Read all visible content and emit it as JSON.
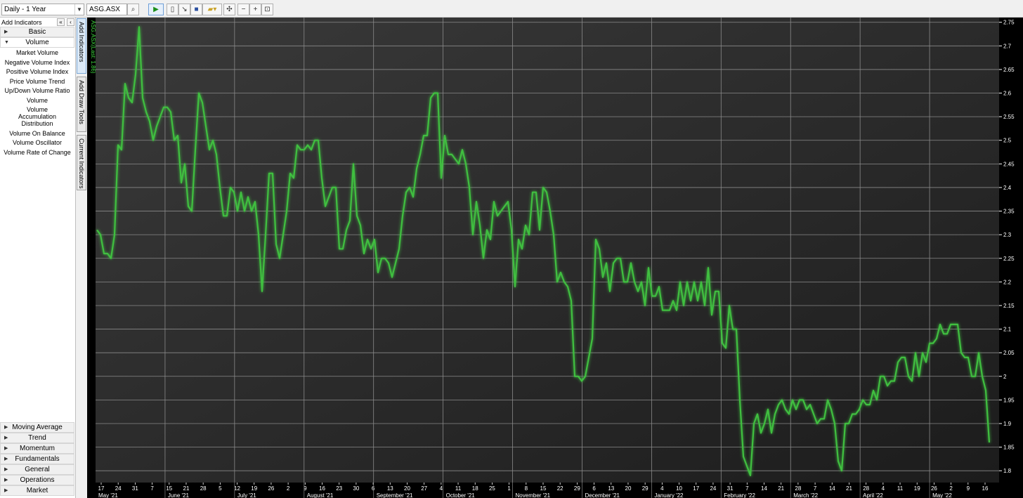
{
  "toolbar": {
    "period_select": "Daily - 1 Year",
    "symbol_input": "ASG.ASX",
    "icons": [
      "search-icon",
      "play-icon",
      "new-icon",
      "export-icon",
      "save-icon",
      "open-icon",
      "settings-icon",
      "zoom-out-icon",
      "zoom-in-icon",
      "fit-icon"
    ]
  },
  "sidebar": {
    "title": "Add Indicators",
    "collapse_left": "«",
    "collapse": "‹",
    "categories_top": [
      {
        "label": "Basic",
        "open": false
      },
      {
        "label": "Volume",
        "open": true
      }
    ],
    "volume_items": [
      "Market Volume",
      "Negative Volume Index",
      "Positive Volume Index",
      "Price Volume Trend",
      "Up/Down Volume Ratio",
      "Volume",
      "Volume Accumulation Distribution",
      "Volume On Balance",
      "Volume Oscillator",
      "Volume Rate of Change"
    ],
    "categories_bottom": [
      "Moving Average",
      "Trend",
      "Momentum",
      "Fundamentals",
      "General",
      "Operations",
      "Market"
    ]
  },
  "vertical_tabs": [
    "Add Indicators",
    "Add Draw Tools",
    "Current Indicators"
  ],
  "chart_data": {
    "type": "line",
    "series": [
      {
        "name": "ASG.ASX",
        "color": "#3fbf3f",
        "values": [
          2.31,
          2.3,
          2.26,
          2.26,
          2.25,
          2.3,
          2.49,
          2.48,
          2.62,
          2.59,
          2.58,
          2.64,
          2.74,
          2.59,
          2.56,
          2.54,
          2.5,
          2.53,
          2.55,
          2.57,
          2.57,
          2.56,
          2.5,
          2.51,
          2.41,
          2.45,
          2.36,
          2.35,
          2.48,
          2.6,
          2.58,
          2.53,
          2.48,
          2.5,
          2.47,
          2.4,
          2.34,
          2.34,
          2.4,
          2.39,
          2.35,
          2.39,
          2.35,
          2.38,
          2.35,
          2.37,
          2.3,
          2.18,
          2.3,
          2.43,
          2.43,
          2.28,
          2.25,
          2.3,
          2.35,
          2.43,
          2.42,
          2.49,
          2.48,
          2.48,
          2.49,
          2.48,
          2.5,
          2.5,
          2.42,
          2.36,
          2.38,
          2.4,
          2.4,
          2.27,
          2.27,
          2.31,
          2.33,
          2.45,
          2.34,
          2.32,
          2.26,
          2.29,
          2.27,
          2.29,
          2.22,
          2.25,
          2.25,
          2.24,
          2.21,
          2.24,
          2.27,
          2.34,
          2.39,
          2.4,
          2.38,
          2.44,
          2.47,
          2.51,
          2.51,
          2.59,
          2.6,
          2.6,
          2.42,
          2.51,
          2.47,
          2.47,
          2.46,
          2.45,
          2.48,
          2.45,
          2.4,
          2.3,
          2.37,
          2.32,
          2.25,
          2.31,
          2.29,
          2.37,
          2.34,
          2.35,
          2.36,
          2.37,
          2.31,
          2.19,
          2.29,
          2.27,
          2.32,
          2.3,
          2.39,
          2.39,
          2.31,
          2.4,
          2.39,
          2.35,
          2.3,
          2.2,
          2.22,
          2.2,
          2.19,
          2.16,
          2.0,
          2.0,
          1.99,
          2.0,
          2.04,
          2.08,
          2.29,
          2.27,
          2.21,
          2.24,
          2.18,
          2.24,
          2.25,
          2.25,
          2.2,
          2.2,
          2.24,
          2.2,
          2.18,
          2.2,
          2.15,
          2.23,
          2.17,
          2.17,
          2.19,
          2.14,
          2.14,
          2.14,
          2.16,
          2.14,
          2.2,
          2.15,
          2.2,
          2.16,
          2.2,
          2.16,
          2.2,
          2.15,
          2.23,
          2.13,
          2.18,
          2.18,
          2.07,
          2.06,
          2.15,
          2.1,
          2.1,
          1.95,
          1.83,
          1.81,
          1.79,
          1.9,
          1.92,
          1.88,
          1.9,
          1.93,
          1.88,
          1.92,
          1.94,
          1.95,
          1.93,
          1.92,
          1.95,
          1.93,
          1.95,
          1.95,
          1.93,
          1.94,
          1.92,
          1.9,
          1.91,
          1.91,
          1.95,
          1.93,
          1.9,
          1.82,
          1.8,
          1.9,
          1.9,
          1.92,
          1.92,
          1.93,
          1.95,
          1.94,
          1.94,
          1.97,
          1.95,
          2.0,
          2.0,
          1.98,
          1.99,
          1.99,
          2.03,
          2.04,
          2.04,
          2.0,
          1.99,
          2.05,
          2.0,
          2.05,
          2.03,
          2.07,
          2.07,
          2.08,
          2.11,
          2.09,
          2.09,
          2.11,
          2.11,
          2.11,
          2.05,
          2.04,
          2.04,
          2.0,
          2.0,
          2.05,
          2.0,
          1.97,
          1.86
        ]
      }
    ],
    "ylim": [
      1.775,
      2.76
    ],
    "y_ticks": [
      "1.8",
      "1.85",
      "1.9",
      "1.95",
      "2",
      "2.05",
      "2.1",
      "2.15",
      "2.2",
      "2.25",
      "2.3",
      "2.35",
      "2.4",
      "2.45",
      "2.5",
      "2.55",
      "2.6",
      "2.65",
      "2.7",
      "2.75"
    ],
    "x_day_ticks": [
      "17",
      "24",
      "31",
      "7",
      "15",
      "21",
      "28",
      "5",
      "12",
      "19",
      "26",
      "2",
      "9",
      "16",
      "23",
      "30",
      "6",
      "13",
      "20",
      "27",
      "4",
      "11",
      "18",
      "25",
      "1",
      "8",
      "15",
      "22",
      "29",
      "6",
      "13",
      "20",
      "29",
      "4",
      "10",
      "17",
      "24",
      "31",
      "7",
      "14",
      "21",
      "28",
      "7",
      "14",
      "21",
      "28",
      "4",
      "11",
      "19",
      "26",
      "2",
      "9",
      "16"
    ],
    "x_month_labels": [
      "May '21",
      "June '21",
      "July '21",
      "August '21",
      "September '21",
      "October '21",
      "November '21",
      "December '21",
      "January '22",
      "February '22",
      "March '22",
      "April '22",
      "May '22"
    ],
    "legend": "ASG.ASX(Last: 1.86)",
    "grid": true,
    "background": "#2b2b2b",
    "gridline_color": "#8a8a8a"
  }
}
